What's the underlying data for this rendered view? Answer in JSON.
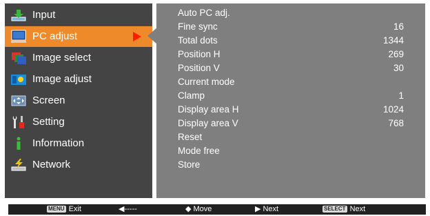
{
  "menu": {
    "items": [
      {
        "label": "Input",
        "icon": "input-icon"
      },
      {
        "label": "PC adjust",
        "icon": "pc-adjust-icon",
        "selected": true
      },
      {
        "label": "Image select",
        "icon": "image-select-icon"
      },
      {
        "label": "Image adjust",
        "icon": "image-adjust-icon"
      },
      {
        "label": "Screen",
        "icon": "screen-icon"
      },
      {
        "label": "Setting",
        "icon": "setting-icon"
      },
      {
        "label": "Information",
        "icon": "information-icon"
      },
      {
        "label": "Network",
        "icon": "network-icon"
      }
    ]
  },
  "submenu": {
    "items": [
      {
        "label": "Auto PC adj.",
        "value": ""
      },
      {
        "label": "Fine sync",
        "value": "16"
      },
      {
        "label": "Total dots",
        "value": "1344"
      },
      {
        "label": "Position H",
        "value": "269"
      },
      {
        "label": "Position V",
        "value": "30"
      },
      {
        "label": "Current mode",
        "value": ""
      },
      {
        "label": "Clamp",
        "value": "1"
      },
      {
        "label": "Display area H",
        "value": "1024"
      },
      {
        "label": "Display area V",
        "value": "768"
      },
      {
        "label": "Reset",
        "value": ""
      },
      {
        "label": "Mode free",
        "value": ""
      },
      {
        "label": "Store",
        "value": ""
      }
    ]
  },
  "footer": {
    "menu_key": "MENU",
    "exit_label": "Exit",
    "back_arrow": "◀-----",
    "move_glyph": "◆",
    "move_label": "Move",
    "next_glyph": "▶",
    "next_label": "Next",
    "select_key": "SELECT",
    "select_next_label": "Next"
  },
  "colors": {
    "selected_bg": "#ef8a2a",
    "left_panel_bg": "#444444",
    "right_panel_bg": "#7f7f7f",
    "pointer": "#ff1a00"
  }
}
